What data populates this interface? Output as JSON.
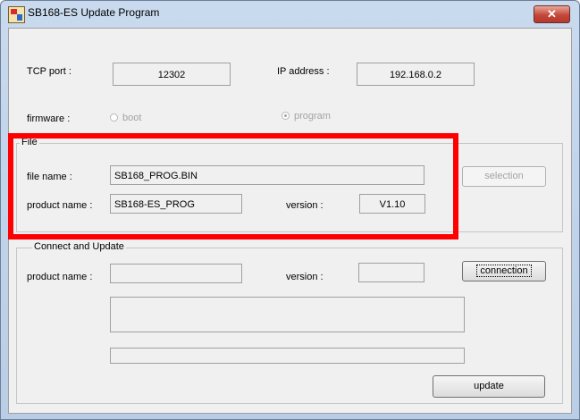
{
  "window": {
    "title": "SB168-ES Update Program",
    "close_glyph": "✕"
  },
  "connection": {
    "tcp_port_label": "TCP port :",
    "tcp_port_value": "12302",
    "ip_label": "IP address :",
    "ip_value": "192.168.0.2"
  },
  "firmware": {
    "label": "firmware :",
    "options": [
      {
        "label": "boot",
        "selected": false
      },
      {
        "label": "program",
        "selected": true
      }
    ]
  },
  "file_group": {
    "title": "File",
    "file_name_label": "file name :",
    "file_name_value": "SB168_PROG.BIN",
    "product_name_label": "product name :",
    "product_name_value": "SB168-ES_PROG",
    "version_label": "version :",
    "version_value": "V1.10",
    "selection_button": "selection"
  },
  "update_group": {
    "title": "Connect and Update",
    "product_name_label": "product name :",
    "product_name_value": "",
    "version_label": "version :",
    "version_value": "",
    "connection_button": "connection",
    "update_button": "update"
  },
  "annotation": {
    "color": "#ff0000"
  }
}
